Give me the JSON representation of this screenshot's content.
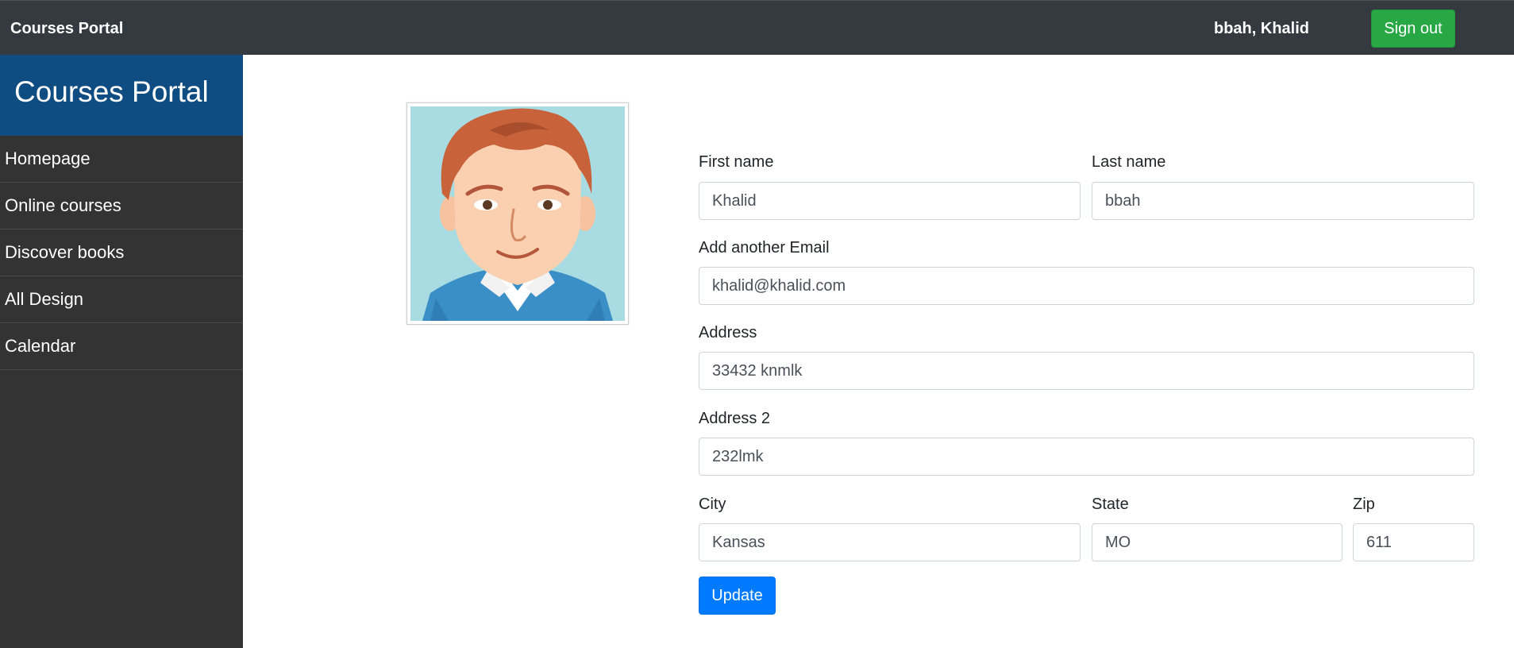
{
  "topbar": {
    "brand": "Courses Portal",
    "username": "bbah, Khalid",
    "signout_label": "Sign out"
  },
  "sidebar": {
    "title": "Courses Portal",
    "items": [
      {
        "label": "Homepage"
      },
      {
        "label": "Online courses"
      },
      {
        "label": "Discover books"
      },
      {
        "label": "All Design"
      },
      {
        "label": "Calendar"
      }
    ]
  },
  "profile": {
    "avatar": "user-avatar-illustration"
  },
  "form": {
    "first_name": {
      "label": "First name",
      "value": "Khalid"
    },
    "last_name": {
      "label": "Last name",
      "value": "bbah"
    },
    "email": {
      "label": "Add another Email",
      "value": "khalid@khalid.com"
    },
    "address": {
      "label": "Address",
      "value": "33432 knmlk"
    },
    "address2": {
      "label": "Address 2",
      "value": "232lmk"
    },
    "city": {
      "label": "City",
      "value": "Kansas"
    },
    "state": {
      "label": "State",
      "value": "MO"
    },
    "zip": {
      "label": "Zip",
      "value": "611"
    },
    "update_label": "Update"
  },
  "colors": {
    "topbar_bg": "#343a40",
    "sidebar_bg": "#333333",
    "sidebar_header_bg": "#0f4c81",
    "signout_bg": "#28a745",
    "update_bg": "#007bff"
  }
}
